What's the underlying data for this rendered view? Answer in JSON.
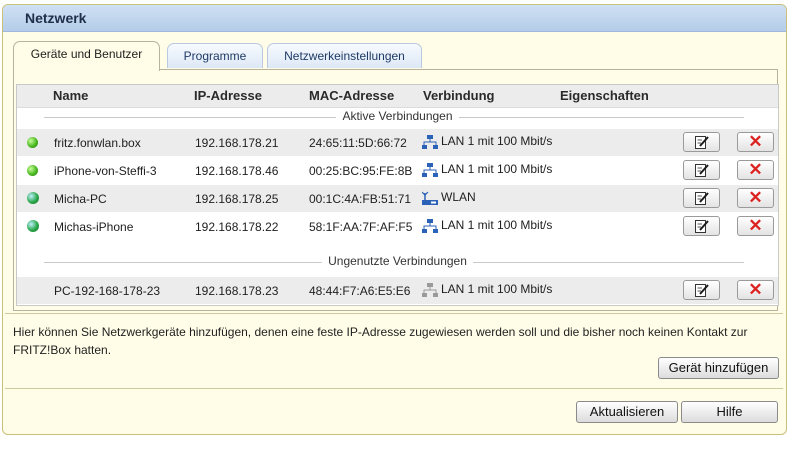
{
  "panel": {
    "title": "Netzwerk"
  },
  "tabs": [
    {
      "label": "Geräte und Benutzer",
      "active": true
    },
    {
      "label": "Programme",
      "active": false
    },
    {
      "label": "Netzwerkeinstellungen",
      "active": false
    }
  ],
  "table": {
    "headers": [
      "Name",
      "IP-Adresse",
      "MAC-Adresse",
      "Verbindung",
      "Eigenschaften"
    ],
    "sections": [
      {
        "label": "Aktive Verbindungen",
        "rows": [
          {
            "status": "online-green",
            "name": "fritz.fonwlan.box",
            "ip": "192.168.178.21",
            "mac": "24:65:11:5D:66:72",
            "conn_icon": "lan-icon",
            "connection": "LAN 1 mit 100 Mbit/s"
          },
          {
            "status": "online-green",
            "name": "iPhone-von-Steffi-3",
            "ip": "192.168.178.46",
            "mac": "00:25:BC:95:FE:8B",
            "conn_icon": "lan-icon",
            "connection": "LAN 1 mit 100 Mbit/s"
          },
          {
            "status": "internet-globe",
            "name": "Micha-PC",
            "ip": "192.168.178.25",
            "mac": "00:1C:4A:FB:51:71",
            "conn_icon": "wlan-icon",
            "connection": "WLAN"
          },
          {
            "status": "internet-globe",
            "name": "Michas-iPhone",
            "ip": "192.168.178.22",
            "mac": "58:1F:AA:7F:AF:F5",
            "conn_icon": "lan-icon",
            "connection": "LAN 1 mit 100 Mbit/s"
          }
        ]
      },
      {
        "label": "Ungenutzte Verbindungen",
        "rows": [
          {
            "status": "none",
            "name": "PC-192-168-178-23",
            "ip": "192.168.178.23",
            "mac": "48:44:F7:A6:E5:E6",
            "conn_icon": "lan-icon-inactive",
            "connection": "LAN 1 mit 100 Mbit/s"
          }
        ]
      }
    ]
  },
  "hint": "Hier können Sie Netzwerkgeräte hinzufügen, denen eine feste IP-Adresse zugewiesen werden soll und die bisher noch keinen Kontakt zur FRITZ!Box hatten.",
  "buttons": {
    "add_device": "Gerät hinzufügen",
    "refresh": "Aktualisieren",
    "help": "Hilfe"
  },
  "colors": {
    "panel_bg": "#fffde7",
    "title_bar": "#b5cde9",
    "delete_red": "#d22222"
  }
}
